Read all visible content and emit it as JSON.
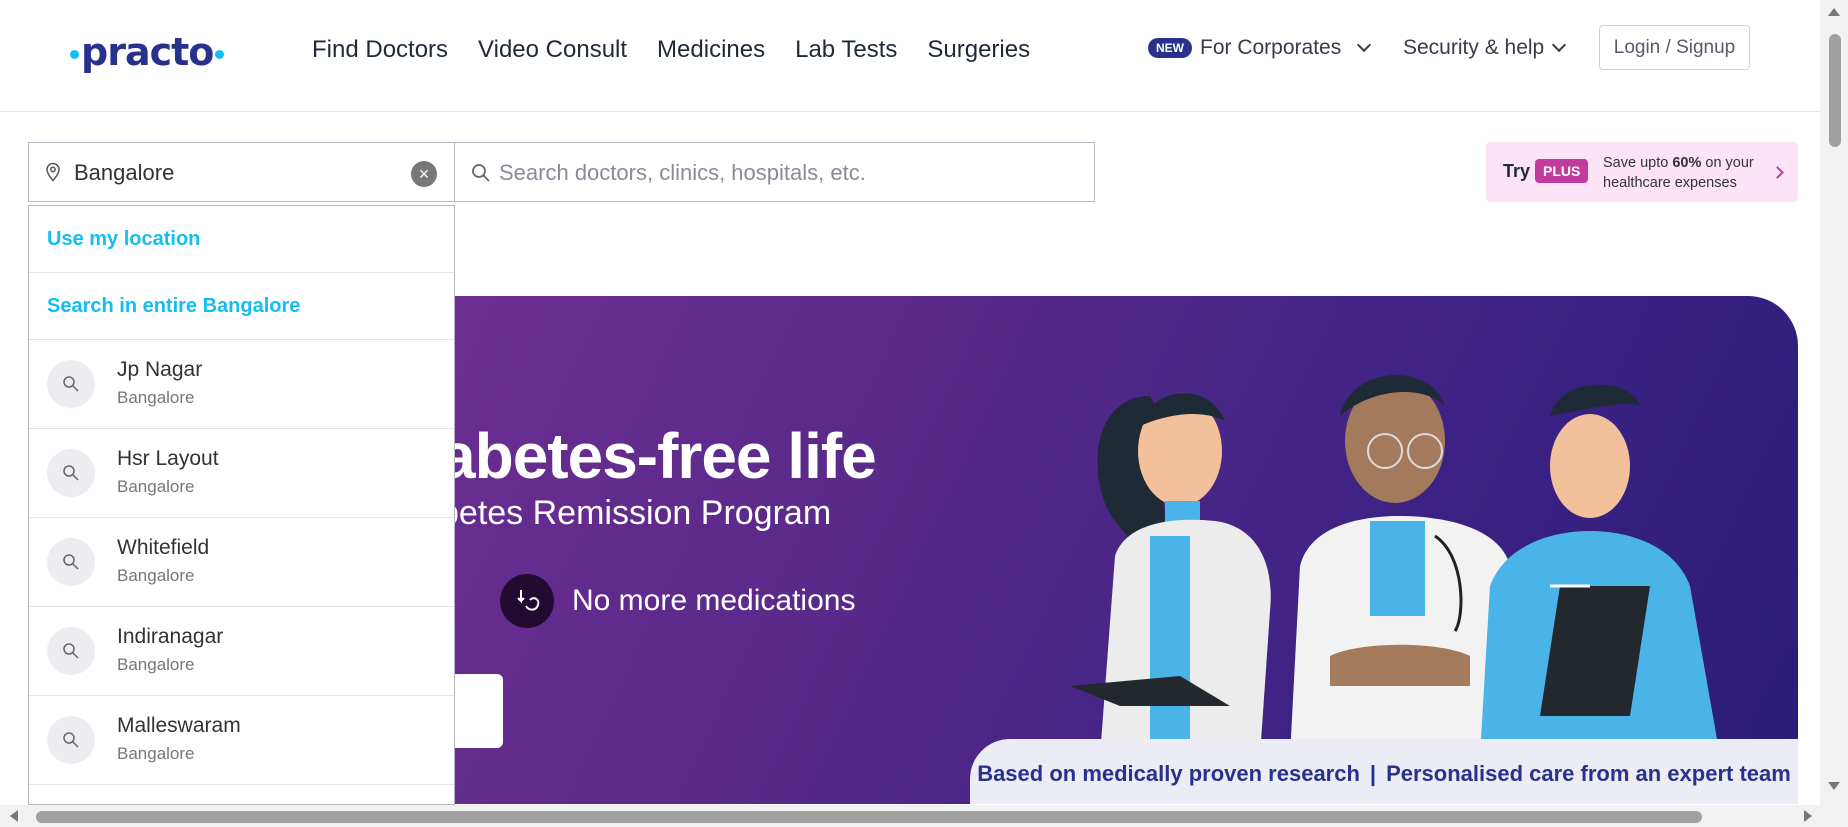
{
  "header": {
    "logo": "practo",
    "nav": [
      "Find Doctors",
      "Video Consult",
      "Medicines",
      "Lab Tests",
      "Surgeries"
    ],
    "new_badge": "NEW",
    "corporates": "For Corporates",
    "security": "Security & help",
    "login": "Login / Signup"
  },
  "search": {
    "location_value": "Bangalore",
    "placeholder": "Search doctors, clinics, hospitals, etc."
  },
  "plus_promo": {
    "try": "Try",
    "plus": "PLUS",
    "save_prefix": "Save upto ",
    "save_pct": "60%",
    "save_suffix": " on your healthcare expenses"
  },
  "dropdown": {
    "use_location": "Use my location",
    "search_entire": "Search in entire Bangalore",
    "items": [
      {
        "name": "Jp Nagar",
        "city": "Bangalore"
      },
      {
        "name": "Hsr Layout",
        "city": "Bangalore"
      },
      {
        "name": "Whitefield",
        "city": "Bangalore"
      },
      {
        "name": "Indiranagar",
        "city": "Bangalore"
      },
      {
        "name": "Malleswaram",
        "city": "Bangalore"
      }
    ]
  },
  "banner": {
    "title": "abetes-free life",
    "subtitle": "betes Remission Program",
    "medication_text": "No more medications",
    "footer_left": "Based on medically proven research",
    "footer_sep": "|",
    "footer_right": "Personalised care from an expert team"
  },
  "colors": {
    "brand": "#14bef0",
    "navy": "#28328c",
    "plus": "#c03d9f"
  }
}
